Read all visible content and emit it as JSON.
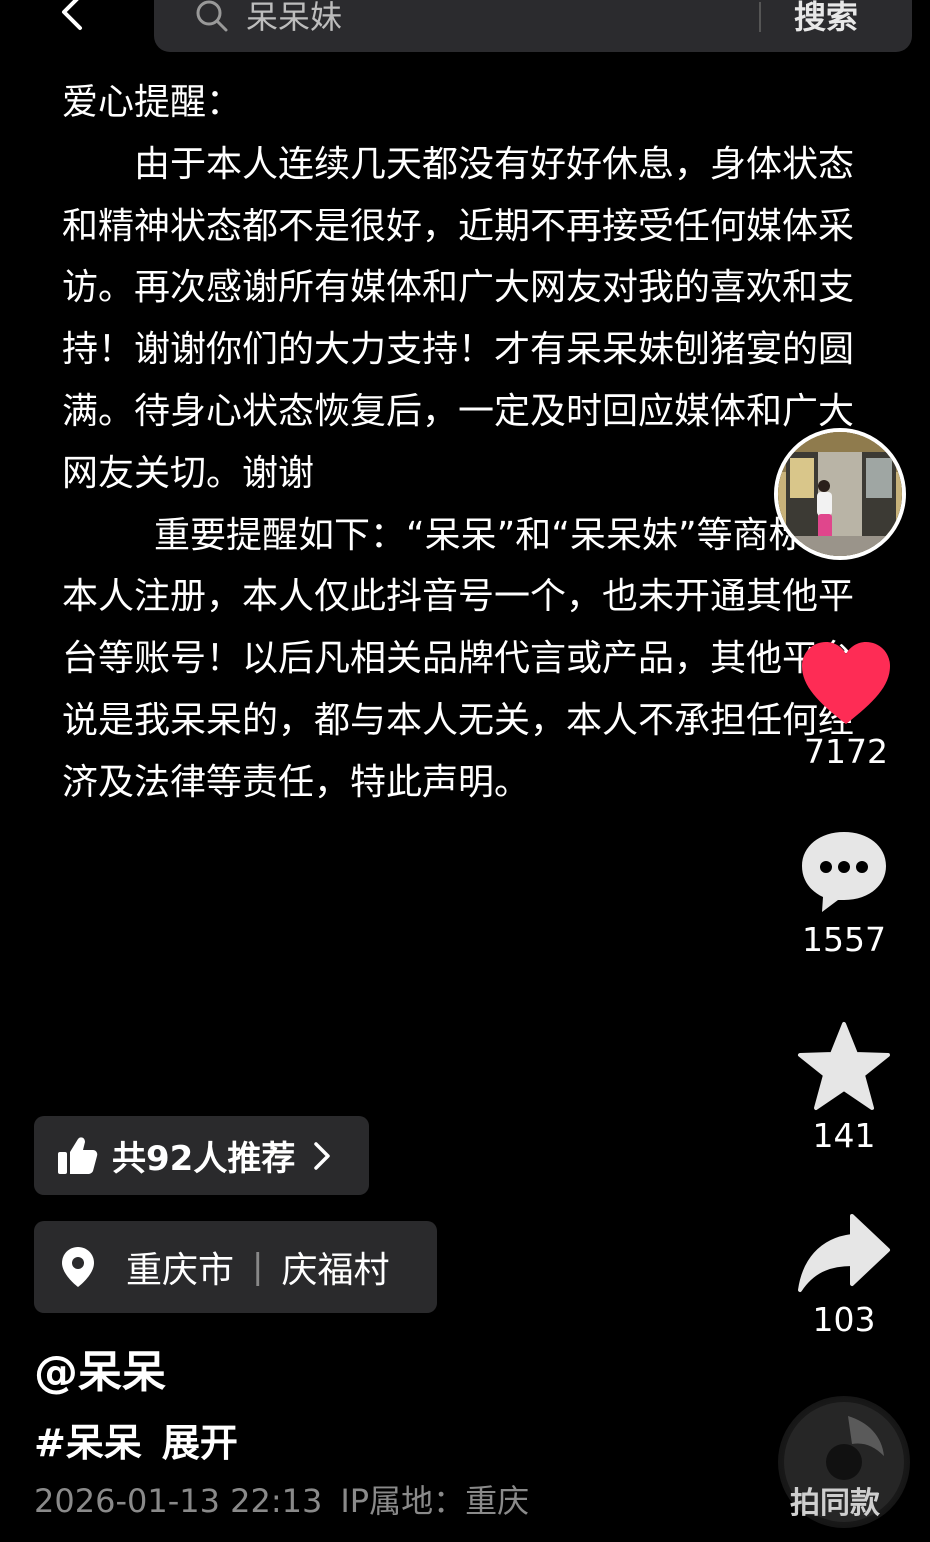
{
  "topbar": {
    "search_query": "呆呆妹",
    "search_button": "搜索"
  },
  "statement": {
    "heading": "爱心提醒：",
    "paragraph1": "由于本人连续几天都没有好好休息，身体状态和精神状态都不是很好，近期不再接受任何媒体采访。再次感谢所有媒体和广大网友对我的喜欢和支持！谢谢你们的大力支持！才有呆呆妹刨猪宴的圆满。待身心状态恢复后，一定及时回应媒体和广大网友关切。谢谢",
    "paragraph2": "重要提醒如下：“呆呆”和“呆呆妹”等商标非本人注册，本人仅此抖音号一个，也未开通其他平台等账号！以后凡相关品牌代言或产品，其他平台说是我呆呆的，都与本人无关，本人不承担任何经济及法律等责任，特此声明。"
  },
  "actions": {
    "likes": "7172",
    "comments": "1557",
    "favorites": "141",
    "shares": "103"
  },
  "music": {
    "label": "拍同款"
  },
  "recommend": {
    "label": "共92人推荐"
  },
  "location": {
    "city": "重庆市",
    "separator": "|",
    "village": "庆福村"
  },
  "post": {
    "author": "@呆呆",
    "hashtag": "#呆呆",
    "expand": "展开",
    "timestamp": "2026-01-13 22:13",
    "ip": "IP属地：重庆"
  },
  "colors": {
    "background": "#000000",
    "pill": "#2a2a2c",
    "like_red": "#fe2c55",
    "muted": "#8a8a8a"
  }
}
